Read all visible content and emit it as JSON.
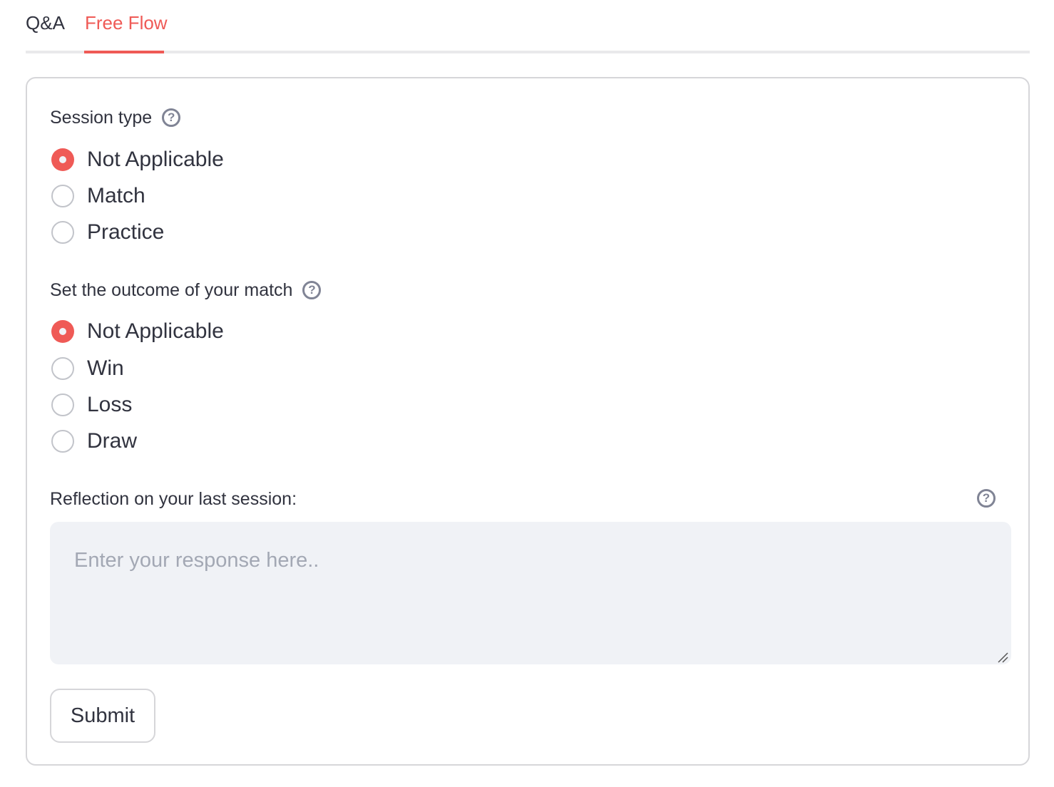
{
  "tabs": [
    {
      "label": "Q&A",
      "active": false
    },
    {
      "label": "Free Flow",
      "active": true
    }
  ],
  "colors": {
    "accent": "#ef5a56",
    "text": "#31333f",
    "input_bg": "#f0f2f6",
    "border": "#d6d6d9",
    "help_icon": "#808495"
  },
  "form": {
    "session_type": {
      "label": "Session type",
      "help_icon": "question-circle-icon",
      "options": [
        "Not Applicable",
        "Match",
        "Practice"
      ],
      "selected": "Not Applicable"
    },
    "outcome": {
      "label": "Set the outcome of your match",
      "help_icon": "question-circle-icon",
      "options": [
        "Not Applicable",
        "Win",
        "Loss",
        "Draw"
      ],
      "selected": "Not Applicable"
    },
    "reflection": {
      "label": "Reflection on your last session:",
      "placeholder": "Enter your response here..",
      "value": "",
      "help_icon": "question-circle-icon"
    },
    "submit_label": "Submit"
  }
}
